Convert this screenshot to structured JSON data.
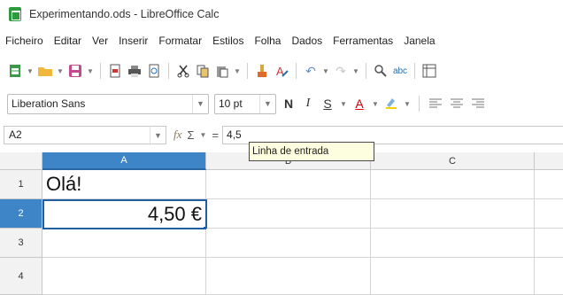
{
  "window": {
    "title": "Experimentando.ods - LibreOffice Calc",
    "icon": "calc-app-icon"
  },
  "menu": [
    "Ficheiro",
    "Editar",
    "Ver",
    "Inserir",
    "Formatar",
    "Estilos",
    "Folha",
    "Dados",
    "Ferramentas",
    "Janela"
  ],
  "toolbar_format": {
    "font_name": "Liberation Sans",
    "font_size": "10 pt",
    "bold": "N",
    "italic": "I",
    "underline": "S",
    "font_color": "A"
  },
  "formula_bar": {
    "name_box": "A2",
    "fx_symbol": "fx",
    "sum_symbol": "Σ",
    "equals_symbol": "=",
    "input_value": "4,5"
  },
  "tooltip": "Linha de entrada",
  "sheet": {
    "columns": [
      "A",
      "B",
      "C"
    ],
    "rows": [
      "1",
      "2",
      "3",
      "4"
    ],
    "cells": {
      "A1": "Olá!",
      "A2": "4,50 €"
    },
    "active_cell": "A2"
  },
  "colors": {
    "selection": "#3d85c6",
    "active_border": "#1f5fa8",
    "tooltip_bg": "#fdfde0"
  }
}
